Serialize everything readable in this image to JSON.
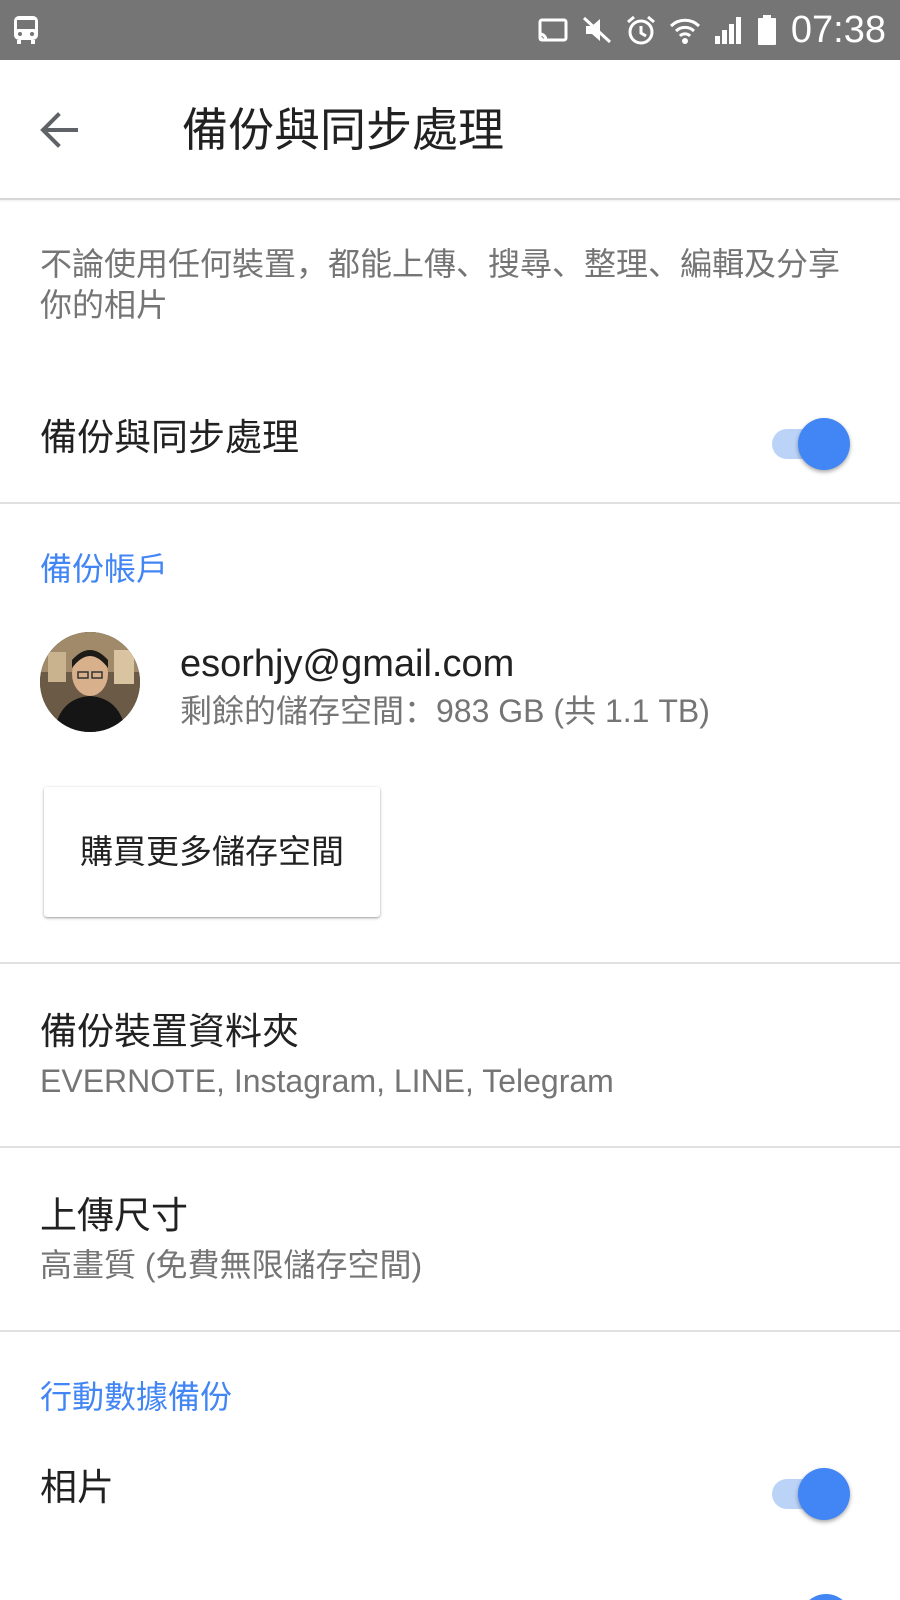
{
  "status_bar": {
    "time": "07:38",
    "icons": [
      "bus-icon",
      "cast-icon",
      "mute-icon",
      "alarm-icon",
      "wifi-icon",
      "signal-icon",
      "battery-icon"
    ]
  },
  "app_bar": {
    "title": "備份與同步處理",
    "back_icon": "arrow-back-icon"
  },
  "description": "不論使用任何裝置，都能上傳、搜尋、整理、編輯及分享你的相片",
  "backup_sync": {
    "label": "備份與同步處理",
    "enabled": true
  },
  "backup_account": {
    "header": "備份帳戶",
    "email": "esorhjy@gmail.com",
    "storage": "剩餘的儲存空間：983 GB (共 1.1 TB)",
    "buy_button": "購買更多儲存空間"
  },
  "device_folders": {
    "title": "備份裝置資料夾",
    "subtitle": "EVERNOTE, Instagram, LINE, Telegram"
  },
  "upload_size": {
    "title": "上傳尺寸",
    "subtitle": "高畫質 (免費無限儲存空間)"
  },
  "mobile_data": {
    "header": "行動數據備份",
    "photos_label": "相片",
    "photos_enabled": true
  },
  "colors": {
    "accent": "#4285f4",
    "status_bar": "#757575",
    "toggle_track": "#bcd3f8"
  }
}
